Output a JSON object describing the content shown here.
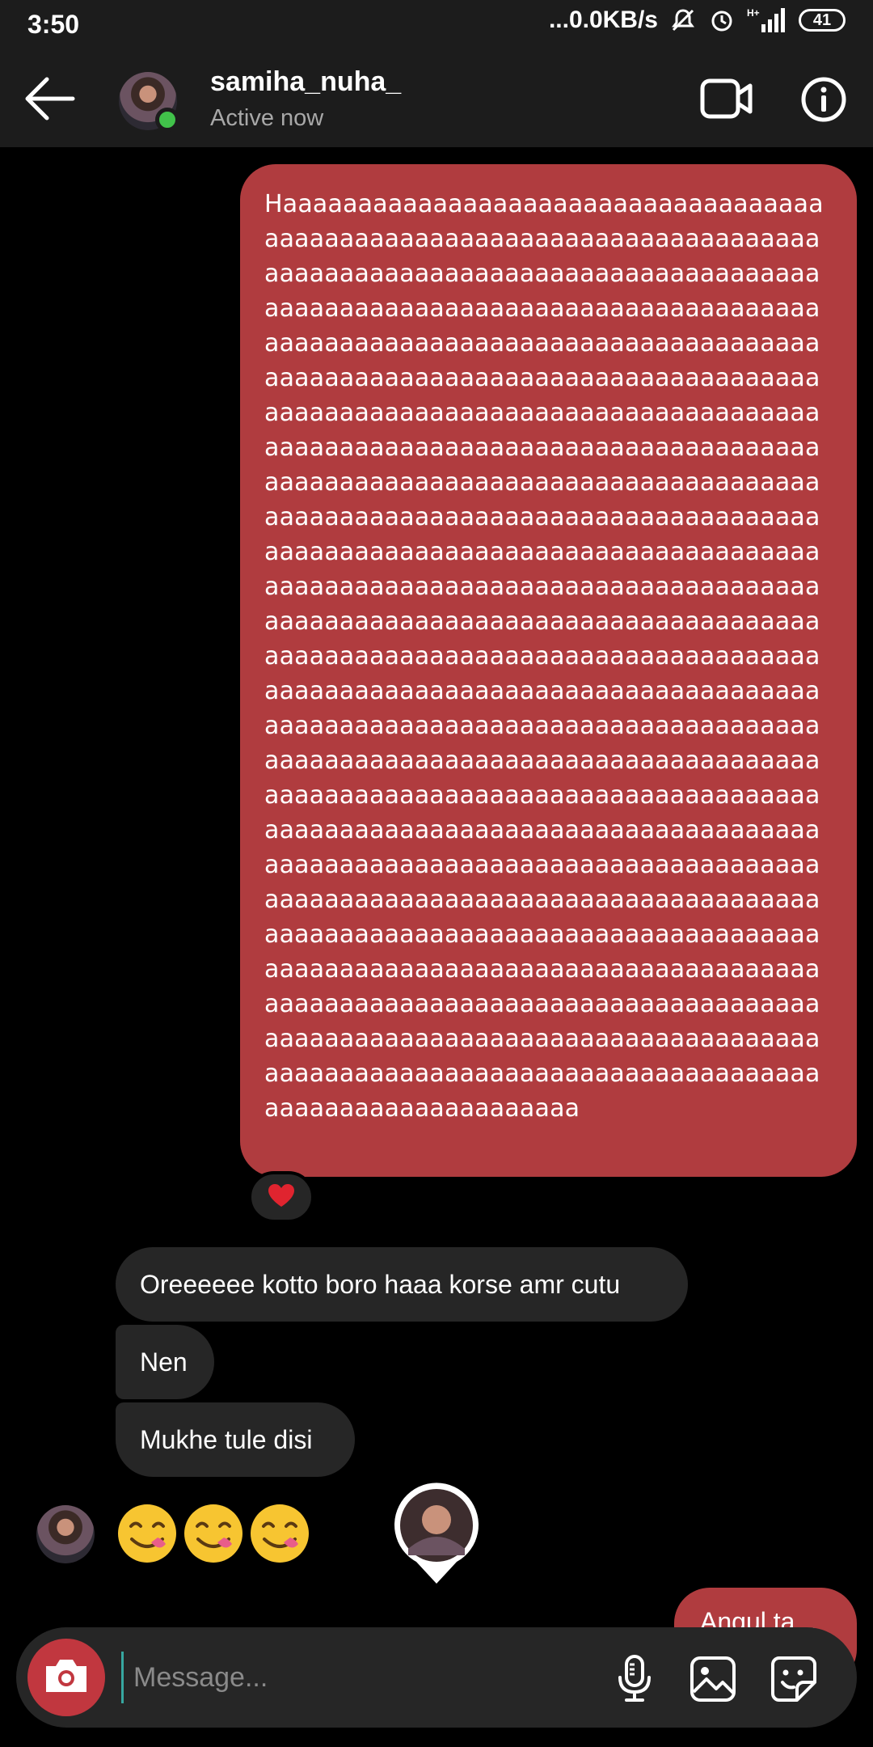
{
  "status_bar": {
    "time": "3:50",
    "network_speed": "...0.0KB/s",
    "network_type": "H+",
    "battery": "41"
  },
  "header": {
    "username": "samiha_nuha_",
    "status": "Active now",
    "back_icon": "arrow-left-icon",
    "video_icon": "video-camera-icon",
    "info_icon": "info-icon",
    "online_color": "#41c24a"
  },
  "messages": {
    "sent_long": "Haaaaaaaaaaaaaaaaaaaaaaaaaaaaaaaaaaaaaaaaaaaaaaaaaaaaaaaaaaaaaaaaaaaaaaaaaaaaaaaaaaaaaaaaaaaaaaaaaaaaaaaaaaaaaaaaaaaaaaaaaaaaaaaaaaaaaaaaaaaaaaaaaaaaaaaaaaaaaaaaaaaaaaaaaaaaaaaaaaaaaaaaaaaaaaaaaaaaaaaaaaaaaaaaaaaaaaaaaaaaaaaaaaaaaaaaaaaaaaaaaaaaaaaaaaaaaaaaaaaaaaaaaaaaaaaaaaaaaaaaaaaaaaaaaaaaaaaaaaaaaaaaaaaaaaaaaaaaaaaaaaaaaaaaaaaaaaaaaaaaaaaaaaaaaaaaaaaaaaaaaaaaaaaaaaaaaaaaaaaaaaaaaaaaaaaaaaaaaaaaaaaaaaaaaaaaaaaaaaaaaaaaaaaaaaaaaaaaaaaaaaaaaaaaaaaaaaaaaaaaaaaaaaaaaaaaaaaaaaaaaaaaaaaaaaaaaaaaaaaaaaaaaaaaaaaaaaaaaaaaaaaaaaaaaaaaaaaaaaaaaaaaaaaaaaaaaaaaaaaaaaaaaaaaaaaaaaaaaaaaaaaaaaaaaaaaaaaaaaaaaaaaaaaaaaaaaaaaaaaaaaaaaaaaaaaaaaaaaaaaaaaaaaaaaaaaaaaaaaaaaaaaaaaaaaaaaaaaaaaaaaaaaaaaaaaaaaaaaaaaaaaaaaaaaaaaaaaaaaaaaaaaaaaaaaaaaaaaaaaaaaaaaaaaaaaaaaaaaaaaaaaaaaaaaaaaaaaaaaaaaaaaaaaaaaaaaaaaaaaaaaaaaaaaaaaaaaaaaaaaaaaaaaaaaaaaaaaaaaaaaaaaaaaaaaaaaaaaaaaaaaaaaaaaaaaaaaaaaaaaaaaaaaaaaaaaaaaaaaaaaaaaaaaaaaaaaaaaaaaaaaaaaaaaaaaaaaaaaaaaaaaaaaaaaaaaaaaaaaaaaaaaaaaaaaaaaaaaaaaaaa",
    "reaction": "❤️",
    "received": [
      "Oreeeeee kotto boro haaa korse amr cutu",
      "Nen",
      "Mukhe tule disi"
    ],
    "emoji_message": "😋😋😋",
    "sent_short": "Angul ta...",
    "sent_color": "#b03c3f",
    "received_color": "#262626"
  },
  "composer": {
    "placeholder": "Message...",
    "camera_icon": "camera-icon",
    "mic_icon": "microphone-icon",
    "gallery_icon": "image-icon",
    "sticker_icon": "sticker-icon",
    "camera_color": "#c1373f"
  }
}
